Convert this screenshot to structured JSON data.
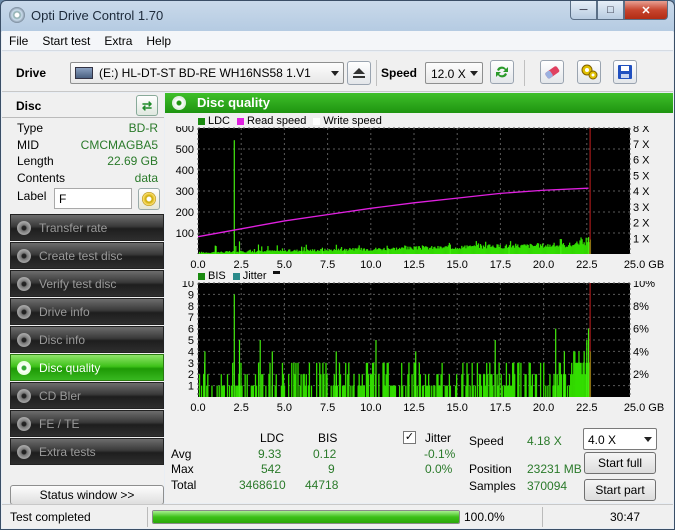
{
  "window": {
    "title": "Opti Drive Control 1.70",
    "min": "─",
    "max": "□",
    "close": "✕"
  },
  "menu": [
    "File",
    "Start test",
    "Extra",
    "Help"
  ],
  "toolbar": {
    "drive_label": "Drive",
    "drive_value": "(E:)   HL-DT-ST BD-RE  WH16NS58 1.V1",
    "speed_label": "Speed",
    "speed_value": "12.0 X"
  },
  "disc": {
    "heading": "Disc",
    "fields": [
      {
        "k": "Type",
        "v": "BD-R"
      },
      {
        "k": "MID",
        "v": "CMCMAGBA5"
      },
      {
        "k": "Length",
        "v": "22.69 GB"
      },
      {
        "k": "Contents",
        "v": "data"
      }
    ],
    "label_key": "Label",
    "label_value": "F"
  },
  "nav": [
    {
      "label": "Transfer rate",
      "active": false
    },
    {
      "label": "Create test disc",
      "active": false
    },
    {
      "label": "Verify test disc",
      "active": false
    },
    {
      "label": "Drive info",
      "active": false
    },
    {
      "label": "Disc info",
      "active": false
    },
    {
      "label": "Disc quality",
      "active": true
    },
    {
      "label": "CD Bler",
      "active": false
    },
    {
      "label": "FE / TE",
      "active": false
    },
    {
      "label": "Extra tests",
      "active": false
    }
  ],
  "status_window_button": "Status window >>",
  "panel_title": "Disc quality",
  "colors": {
    "ldc": "#1a8a10",
    "read": "#e020e0",
    "write": "#ffffff",
    "bis": "#1a8a10",
    "jitter": "#2a8a8a",
    "bar": "#33dd00",
    "marker": "#cc2020"
  },
  "chart_data": [
    {
      "type": "bar",
      "legend": [
        "LDC",
        "Read speed",
        "Write speed"
      ],
      "x_ticks": [
        "0.0",
        "2.5",
        "5.0",
        "7.5",
        "10.0",
        "12.5",
        "15.0",
        "17.5",
        "20.0",
        "22.5",
        "25.0 GB"
      ],
      "y_ticks": [
        "600",
        "500",
        "400",
        "300",
        "200",
        "100"
      ],
      "y2_ticks": [
        "8 X",
        "7 X",
        "6 X",
        "5 X",
        "4 X",
        "3 X",
        "2 X",
        "1 X"
      ],
      "ylim": [
        0,
        600
      ],
      "y2lim": [
        0,
        8
      ],
      "xlim": [
        0,
        25
      ],
      "spikes": [
        [
          2.1,
          542
        ],
        [
          2.4,
          60
        ],
        [
          1.0,
          40
        ],
        [
          3.5,
          45
        ],
        [
          6.0,
          35
        ],
        [
          7.2,
          30
        ],
        [
          8.5,
          25
        ],
        [
          11.0,
          28
        ],
        [
          14.6,
          45
        ],
        [
          18.0,
          30
        ],
        [
          21.0,
          35
        ],
        [
          22.6,
          80
        ]
      ],
      "read_speed": [
        [
          0.0,
          1.1
        ],
        [
          2.5,
          1.6
        ],
        [
          5.0,
          2.1
        ],
        [
          7.5,
          2.5
        ],
        [
          10.0,
          2.9
        ],
        [
          12.5,
          3.25
        ],
        [
          15.0,
          3.55
        ],
        [
          17.5,
          3.85
        ],
        [
          20.0,
          4.05
        ],
        [
          22.6,
          4.18
        ]
      ],
      "end_marker": 22.69
    },
    {
      "type": "bar",
      "legend": [
        "BIS",
        "Jitter"
      ],
      "x_ticks": [
        "0.0",
        "2.5",
        "5.0",
        "7.5",
        "10.0",
        "12.5",
        "15.0",
        "17.5",
        "20.0",
        "22.5",
        "25.0 GB"
      ],
      "y_ticks": [
        "10",
        "9",
        "8",
        "7",
        "6",
        "5",
        "4",
        "3",
        "2",
        "1"
      ],
      "y2_ticks": [
        "10%",
        "8%",
        "6%",
        "4%",
        "2%"
      ],
      "ylim": [
        0,
        10
      ],
      "y2lim": [
        0,
        10
      ],
      "xlim": [
        0,
        25
      ],
      "spikes": [
        [
          2.1,
          9
        ],
        [
          2.4,
          5
        ],
        [
          0.4,
          4
        ],
        [
          3.6,
          5
        ],
        [
          4.3,
          4
        ],
        [
          8.0,
          4
        ],
        [
          10.3,
          5
        ],
        [
          12.6,
          4
        ],
        [
          17.2,
          5
        ],
        [
          20.7,
          6
        ],
        [
          21.2,
          4
        ],
        [
          22.5,
          5
        ],
        [
          22.6,
          6
        ]
      ],
      "end_marker": 22.69
    }
  ],
  "stats": {
    "col_ldc": "LDC",
    "col_bis": "BIS",
    "col_jitter": "Jitter",
    "rows": [
      {
        "label": "Avg",
        "ldc": "9.33",
        "bis": "0.12",
        "jitter": "-0.1%"
      },
      {
        "label": "Max",
        "ldc": "542",
        "bis": "9",
        "jitter": "0.0%"
      },
      {
        "label": "Total",
        "ldc": "3468610",
        "bis": "44718",
        "jitter": ""
      }
    ],
    "speed_label": "Speed",
    "speed_value": "4.18 X",
    "position_label": "Position",
    "position_value": "23231 MB",
    "samples_label": "Samples",
    "samples_value": "370094",
    "test_speed": "4.0 X",
    "start_full": "Start full",
    "start_part": "Start part"
  },
  "statusbar": {
    "text": "Test completed",
    "progress": 100.0,
    "progress_text": "100.0%",
    "time": "30:47"
  }
}
